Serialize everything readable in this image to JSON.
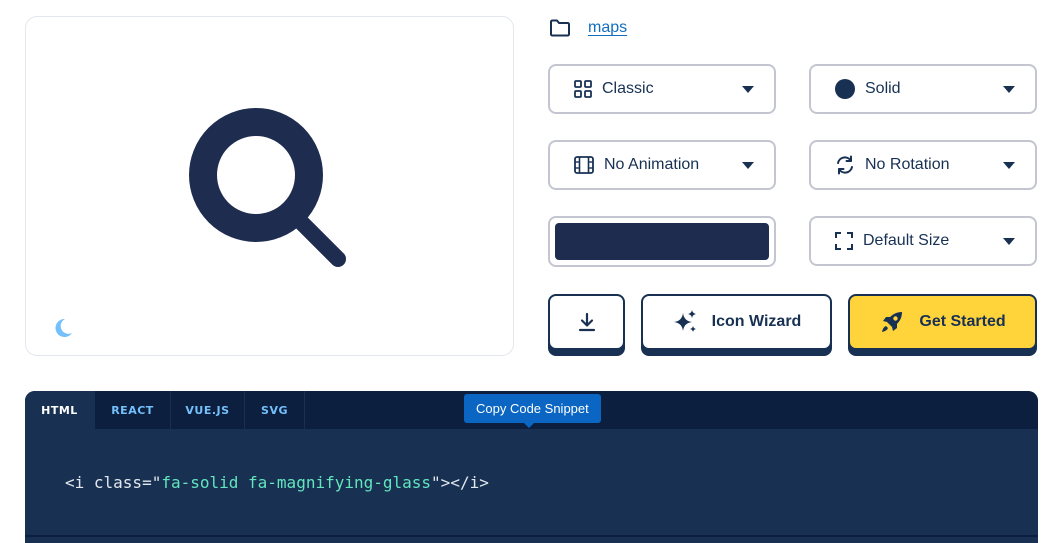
{
  "preview": {
    "icon": "magnifying-glass-icon",
    "theme_toggle_icon": "moon-icon"
  },
  "category": {
    "icon": "folder-icon",
    "link": "maps"
  },
  "family_select": {
    "icon": "grid-icon",
    "label": "Classic"
  },
  "style_select": {
    "icon": "circle-icon",
    "label": "Solid"
  },
  "animation_select": {
    "icon": "film-icon",
    "label": "No Animation"
  },
  "rotation_select": {
    "icon": "rotate-icon",
    "label": "No Rotation"
  },
  "color_picker": {
    "value": "#1e2c4f"
  },
  "size_select": {
    "icon": "expand-icon",
    "label": "Default Size"
  },
  "buttons": {
    "download": {
      "icon": "download-icon"
    },
    "wizard": {
      "icon": "sparkles-icon",
      "label": "Icon Wizard"
    },
    "get_started": {
      "icon": "rocket-icon",
      "label": "Get Started"
    }
  },
  "code": {
    "tabs": [
      "HTML",
      "REACT",
      "VUE.JS",
      "SVG"
    ],
    "active_tab": "HTML",
    "snippet_prefix": "<i class=\"",
    "snippet_class": "fa-solid fa-magnifying-glass",
    "snippet_suffix": "\"></i>",
    "tooltip": "Copy Code Snippet"
  },
  "colors": {
    "navy": "#183153",
    "yellow": "#ffd43b",
    "link": "#146ebe",
    "tooltip": "#0a66c2",
    "code_string": "#63e6be"
  }
}
